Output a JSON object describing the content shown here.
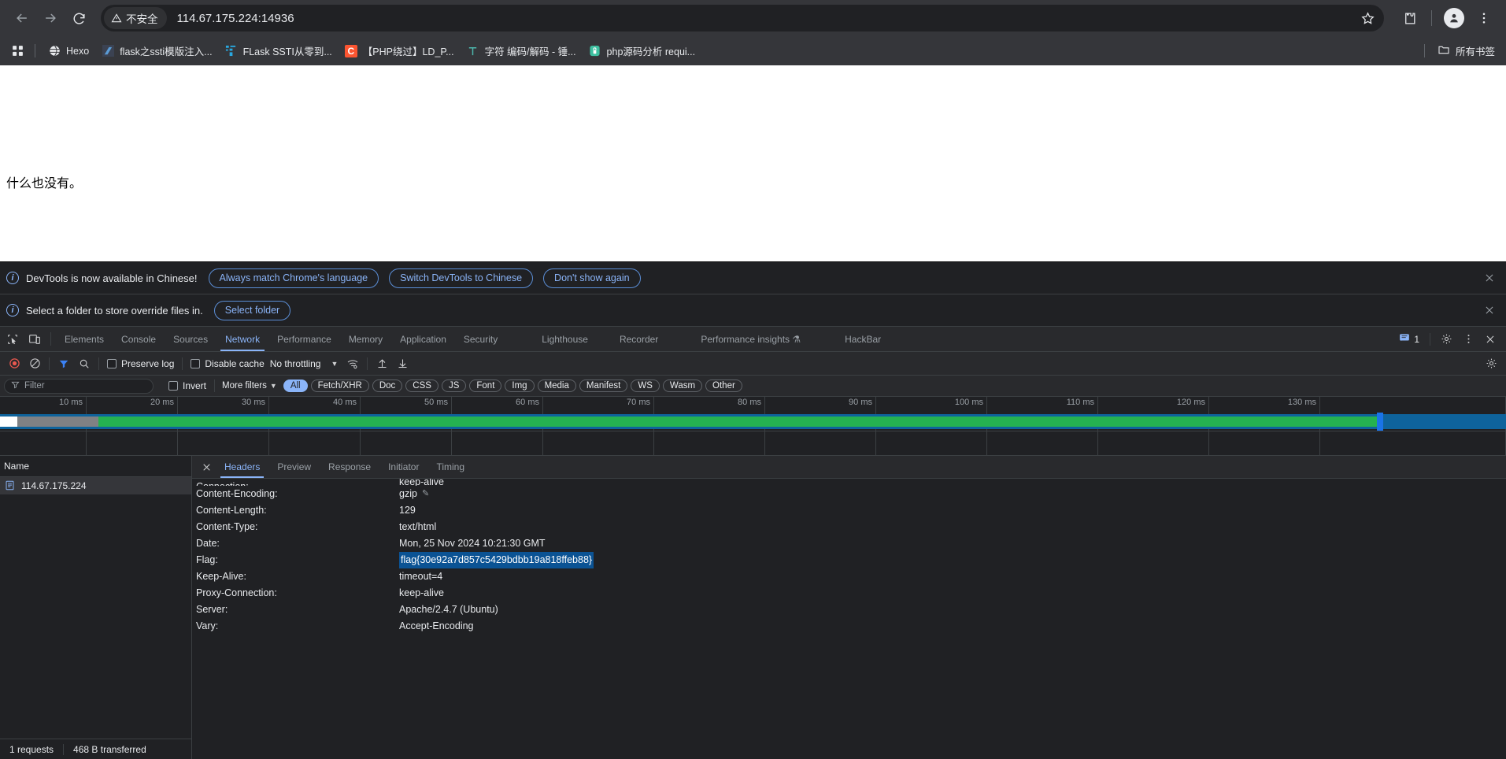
{
  "browser": {
    "security_chip": "不安全",
    "url": "114.67.175.224:14936",
    "back_icon": "back-arrow-icon",
    "forward_icon": "forward-arrow-icon",
    "reload_icon": "reload-icon",
    "bookmark_star_icon": "star-icon",
    "extensions_icon": "puzzle-piece-icon",
    "profile_icon": "profile-avatar-icon",
    "menu_icon": "three-dot-menu-icon"
  },
  "bookmarks": {
    "apps_icon": "apps-grid-icon",
    "items": [
      {
        "label": "Hexo",
        "favicon": "globe-icon",
        "color": "#e8eaed"
      },
      {
        "label": "flask之ssti模版注入...",
        "favicon": "blue-note-icon",
        "color": "#4a6fa5"
      },
      {
        "label": "FLask SSTI从零到...",
        "favicon": "csdn-icon",
        "color": "#2ea7e0"
      },
      {
        "label": "【PHP绕过】LD_P...",
        "favicon": "csdn-c-icon",
        "color": "#fc5531"
      },
      {
        "label": "字符 编码/解码 - 锤...",
        "favicon": "hammer-icon",
        "color": "#4db6ac"
      },
      {
        "label": "php源码分析 requi...",
        "favicon": "lock-icon",
        "color": "#3ebfa0"
      }
    ],
    "all_bookmarks_label": "所有书签",
    "all_bookmarks_icon": "folder-icon"
  },
  "page": {
    "content_text": "什么也没有。"
  },
  "devtools": {
    "infobars": [
      {
        "icon": "info-icon",
        "text": "DevTools is now available in Chinese!",
        "buttons": [
          "Always match Chrome's language",
          "Switch DevTools to Chinese",
          "Don't show again"
        ],
        "close_icon": "close-icon"
      },
      {
        "icon": "info-icon",
        "text": "Select a folder to store override files in.",
        "buttons": [
          "Select folder"
        ],
        "close_icon": "close-icon"
      }
    ],
    "tabs": [
      {
        "label": "Elements",
        "active": false
      },
      {
        "label": "Console",
        "active": false
      },
      {
        "label": "Sources",
        "active": false
      },
      {
        "label": "Network",
        "active": true
      },
      {
        "label": "Performance",
        "active": false
      },
      {
        "label": "Memory",
        "active": false
      },
      {
        "label": "Application",
        "active": false
      },
      {
        "label": "Security",
        "active": false
      },
      {
        "label": "Lighthouse",
        "active": false
      },
      {
        "label": "Recorder",
        "active": false
      },
      {
        "label": "Performance insights ⚗",
        "active": false
      },
      {
        "label": "HackBar",
        "active": false
      }
    ],
    "inspect_icon": "inspect-element-icon",
    "device_icon": "device-toolbar-icon",
    "message_count": "1",
    "message_icon": "message-icon",
    "settings_icon": "gear-icon",
    "more_icon": "three-dot-menu-icon",
    "close_icon": "close-icon",
    "network_toolbar": {
      "record_icon": "record-circle-icon",
      "clear_icon": "clear-no-entry-icon",
      "filter_icon": "filter-funnel-icon",
      "search_icon": "search-icon",
      "preserve_log": "Preserve log",
      "disable_cache": "Disable cache",
      "throttling": "No throttling",
      "wifi_icon": "wifi-settings-icon",
      "import_icon": "upload-arrow-icon",
      "export_icon": "download-arrow-icon",
      "settings_icon": "gear-icon"
    },
    "filter_row": {
      "filter_placeholder": "Filter",
      "filter_icon": "filter-funnel-icon",
      "invert": "Invert",
      "more_filters": "More filters",
      "types": [
        "All",
        "Fetch/XHR",
        "Doc",
        "CSS",
        "JS",
        "Font",
        "Img",
        "Media",
        "Manifest",
        "WS",
        "Wasm",
        "Other"
      ],
      "active_type": "All"
    },
    "overview": {
      "ticks": [
        "10 ms",
        "20 ms",
        "30 ms",
        "40 ms",
        "50 ms",
        "60 ms",
        "70 ms",
        "80 ms",
        "90 ms",
        "100 ms",
        "110 ms",
        "120 ms",
        "130 ms"
      ]
    },
    "request_list": {
      "column_header": "Name",
      "rows": [
        {
          "name": "114.67.175.224",
          "icon": "document-icon",
          "selected": true
        }
      ],
      "footer": {
        "requests": "1 requests",
        "transferred": "468 B transferred"
      }
    },
    "detail": {
      "close_icon": "close-icon",
      "tabs": [
        {
          "label": "Headers",
          "active": true
        },
        {
          "label": "Preview",
          "active": false
        },
        {
          "label": "Response",
          "active": false
        },
        {
          "label": "Initiator",
          "active": false
        },
        {
          "label": "Timing",
          "active": false
        }
      ],
      "headers": [
        {
          "name": "Connection:",
          "value": "keep-alive",
          "clipped": true
        },
        {
          "name": "Content-Encoding:",
          "value": "gzip",
          "editable": true
        },
        {
          "name": "Content-Length:",
          "value": "129"
        },
        {
          "name": "Content-Type:",
          "value": "text/html"
        },
        {
          "name": "Date:",
          "value": "Mon, 25 Nov 2024 10:21:30 GMT"
        },
        {
          "name": "Flag:",
          "value": "flag{30e92a7d857c5429bdbb19a818ffeb88}",
          "selected": true
        },
        {
          "name": "Keep-Alive:",
          "value": "timeout=4"
        },
        {
          "name": "Proxy-Connection:",
          "value": "keep-alive"
        },
        {
          "name": "Server:",
          "value": "Apache/2.4.7 (Ubuntu)"
        },
        {
          "name": "Vary:",
          "value": "Accept-Encoding"
        }
      ]
    }
  }
}
